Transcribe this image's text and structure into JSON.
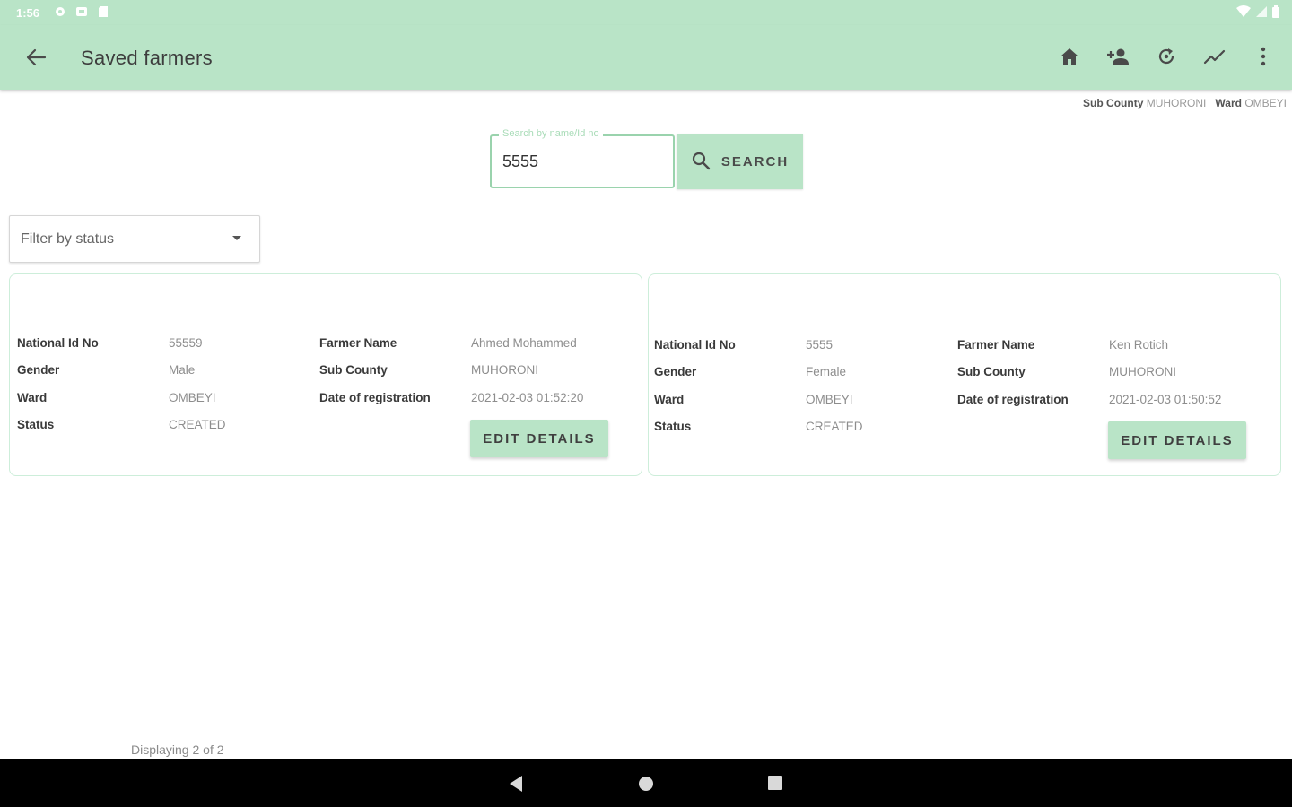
{
  "status_bar": {
    "time": "1:56"
  },
  "app_bar": {
    "title": "Saved farmers"
  },
  "location": {
    "sub_county_label": "Sub County",
    "sub_county_value": "MUHORONI",
    "ward_label": "Ward",
    "ward_value": "OMBEYI"
  },
  "search": {
    "placeholder": "Search by name/Id no",
    "value": "5555",
    "button_label": "SEARCH"
  },
  "filter": {
    "placeholder": "Filter by status"
  },
  "labels": {
    "national_id": "National Id No",
    "gender": "Gender",
    "ward": "Ward",
    "status": "Status",
    "farmer_name": "Farmer Name",
    "sub_county": "Sub County",
    "date_registration": "Date of registration",
    "edit_button": "EDIT DETAILS"
  },
  "farmers": [
    {
      "national_id": "55559",
      "gender": "Male",
      "ward": "OMBEYI",
      "status": "CREATED",
      "farmer_name": "Ahmed Mohammed",
      "sub_county": "MUHORONI",
      "date_registration": "2021-02-03 01:52:20"
    },
    {
      "national_id": "5555",
      "gender": "Female",
      "ward": "OMBEYI",
      "status": "CREATED",
      "farmer_name": "Ken Rotich",
      "sub_county": "MUHORONI",
      "date_registration": "2021-02-03 01:50:52"
    }
  ],
  "footer": {
    "displaying": "Displaying 2 of 2"
  },
  "colors": {
    "accent": "#b9e4c7",
    "nav_bar": "#000000"
  }
}
